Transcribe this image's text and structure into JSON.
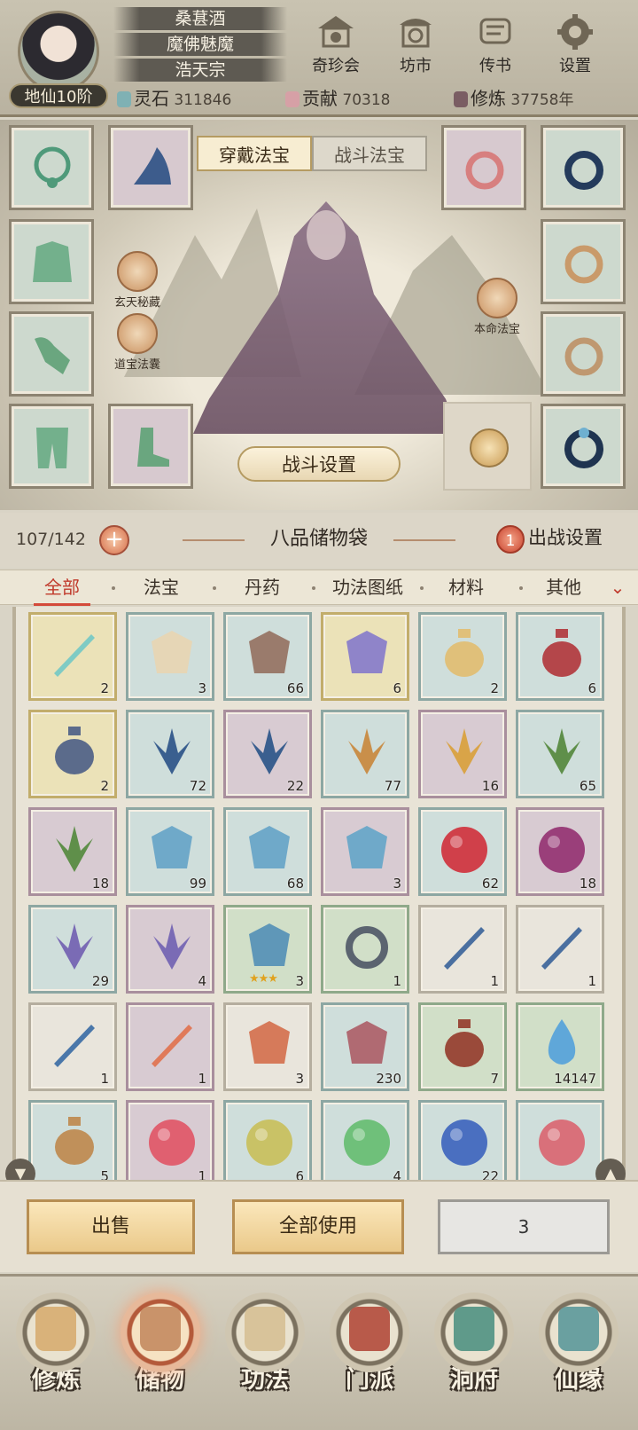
{
  "player": {
    "rank": "地仙10阶",
    "names": [
      "桑葚酒",
      "魔佛魅魔",
      "浩天宗"
    ]
  },
  "top_buttons": [
    {
      "label": "奇珍会",
      "icon": "treasure-pavilion-icon"
    },
    {
      "label": "坊市",
      "icon": "market-icon"
    },
    {
      "label": "传书",
      "icon": "scroll-message-icon"
    },
    {
      "label": "设置",
      "icon": "gear-icon"
    }
  ],
  "resources": [
    {
      "label": "灵石",
      "value": "311846",
      "icon": "spirit-stone-icon"
    },
    {
      "label": "贡献",
      "value": "70318",
      "icon": "contribution-icon"
    },
    {
      "label": "修炼",
      "value": "37758年",
      "icon": "cultivation-icon"
    }
  ],
  "equip_tabs": {
    "wear": "穿戴法宝",
    "battle": "战斗法宝"
  },
  "side_buttons": {
    "secret": "玄天秘藏",
    "bag": "道宝法囊",
    "natal": "本命法宝"
  },
  "fight_setting": "战斗设置",
  "bag": {
    "capacity": "107/142",
    "plus": "+",
    "title": "八品储物袋",
    "battle_badge": "1",
    "battle_setting": "出战设置"
  },
  "categories": [
    "全部",
    "法宝",
    "丹药",
    "功法图纸",
    "材料",
    "其他"
  ],
  "chevron": "⌄",
  "items": [
    {
      "r": "gold",
      "icon": "jade-bowl-icon",
      "c": "2"
    },
    {
      "r": "blue",
      "icon": "book-icon",
      "c": "3"
    },
    {
      "r": "blue",
      "icon": "pouch-icon",
      "c": "66"
    },
    {
      "r": "gold",
      "icon": "crystal-shard-icon",
      "c": "6"
    },
    {
      "r": "blue",
      "icon": "gold-teapot-icon",
      "c": "2"
    },
    {
      "r": "blue",
      "icon": "wine-jar-icon",
      "c": "6"
    },
    {
      "r": "gold",
      "icon": "porcelain-jar-icon",
      "c": "2"
    },
    {
      "r": "blue",
      "icon": "blue-lily-icon",
      "c": "72"
    },
    {
      "r": "purple",
      "icon": "blue-lily-icon",
      "c": "22"
    },
    {
      "r": "blue",
      "icon": "dry-grass-icon",
      "c": "77"
    },
    {
      "r": "purple",
      "icon": "glowing-grass-icon",
      "c": "16"
    },
    {
      "r": "blue",
      "icon": "herb-leaf-icon",
      "c": "65"
    },
    {
      "r": "purple",
      "icon": "herb-leaf-icon",
      "c": "18"
    },
    {
      "r": "blue",
      "icon": "blue-shell-icon",
      "c": "99"
    },
    {
      "r": "blue",
      "icon": "blue-shell-icon",
      "c": "68"
    },
    {
      "r": "purple",
      "icon": "blue-shell-icon",
      "c": "3"
    },
    {
      "r": "blue",
      "icon": "red-urchin-icon",
      "c": "62"
    },
    {
      "r": "purple",
      "icon": "purple-urchin-icon",
      "c": "18"
    },
    {
      "r": "blue",
      "icon": "mushroom-icon",
      "c": "29"
    },
    {
      "r": "purple",
      "icon": "mushroom-icon",
      "c": "4"
    },
    {
      "r": "green",
      "icon": "talisman-icon",
      "c": "3",
      "stars": "★★★"
    },
    {
      "r": "green",
      "icon": "iron-ring-icon",
      "c": "1"
    },
    {
      "r": "white",
      "icon": "bow-icon",
      "c": "1"
    },
    {
      "r": "white",
      "icon": "bow-icon",
      "c": "1"
    },
    {
      "r": "white",
      "icon": "sword-icon",
      "c": "1"
    },
    {
      "r": "purple",
      "icon": "flame-blade-icon",
      "c": "1"
    },
    {
      "r": "white",
      "icon": "scarf-icon",
      "c": "3"
    },
    {
      "r": "blue",
      "icon": "ore-pile-icon",
      "c": "230"
    },
    {
      "r": "green",
      "icon": "gourd-icon",
      "c": "7"
    },
    {
      "r": "green",
      "icon": "water-drop-icon",
      "c": "14147"
    },
    {
      "r": "blue",
      "icon": "talisman-bottle-icon",
      "c": "5"
    },
    {
      "r": "purple",
      "icon": "red-orb-icon",
      "c": "1"
    },
    {
      "r": "blue",
      "icon": "yellow-orb-icon",
      "c": "6"
    },
    {
      "r": "blue",
      "icon": "green-orb-icon",
      "c": "4"
    },
    {
      "r": "blue",
      "icon": "blue-orb-icon",
      "c": "22"
    },
    {
      "r": "blue",
      "icon": "pink-orb-icon",
      "c": ""
    }
  ],
  "actions": {
    "sell": "出售",
    "use_all": "全部使用",
    "quantity": "3"
  },
  "nav": [
    {
      "label": "修炼",
      "icon": "cultivate-icon",
      "active": false
    },
    {
      "label": "储物",
      "icon": "storage-bag-icon",
      "active": true
    },
    {
      "label": "功法",
      "icon": "technique-scroll-icon",
      "active": false
    },
    {
      "label": "门派",
      "icon": "sect-gate-icon",
      "active": false
    },
    {
      "label": "洞府",
      "icon": "cave-dwelling-icon",
      "active": false
    },
    {
      "label": "仙缘",
      "icon": "immortal-fate-icon",
      "active": false
    }
  ],
  "colors": {
    "accent": "#c0392b",
    "panel": "#e8e3d6"
  }
}
